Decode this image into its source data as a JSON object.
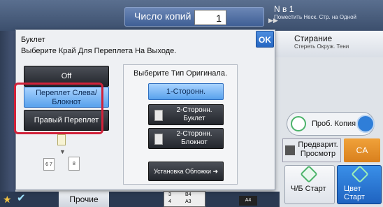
{
  "header": {
    "copies_label": "Число копий",
    "copies_value": "1"
  },
  "right_panel": {
    "item1_title": "N в 1",
    "item1_subtitle": "Поместить Неск. Стр. на Одной",
    "item2_title": "Стирание",
    "item2_subtitle": "Стереть Окруж. Тени",
    "proof_copy": "Проб. Копия",
    "preview": "Предварит. Просмотр",
    "ca": "CA",
    "bw_start": "Ч/Б Старт",
    "color_start": "Цвет Старт"
  },
  "bottom_bar": {
    "other": "Прочие",
    "tray_rows": [
      "3",
      "B4",
      "4",
      "A3"
    ],
    "paper": "A4"
  },
  "dialog": {
    "title": "Буклет",
    "subtitle": "Выберите Край Для Переплета На Выходе.",
    "ok": "OK",
    "options": {
      "off": "Off",
      "left_binding": "Переплет Слева/ Блокнот",
      "right_binding": "Правый Переплет"
    },
    "illustration": {
      "page_a": "6 7",
      "page_b": "8"
    },
    "original_type": {
      "title": "Выберите Тип Оригинала.",
      "one_sided": "1-Сторонн.",
      "two_sided_booklet": "2-Сторонн. Буклет",
      "two_sided_tablet": "2-Сторонн. Блокнот"
    },
    "cover_setting": "Установка Обложки",
    "selected_binding": "left_binding",
    "selected_original": "one_sided"
  },
  "colors": {
    "selected_blue": "#58a1ec",
    "highlight_red": "#d1223a",
    "dark_button": "#23262c",
    "ca_orange": "#d9801d"
  }
}
